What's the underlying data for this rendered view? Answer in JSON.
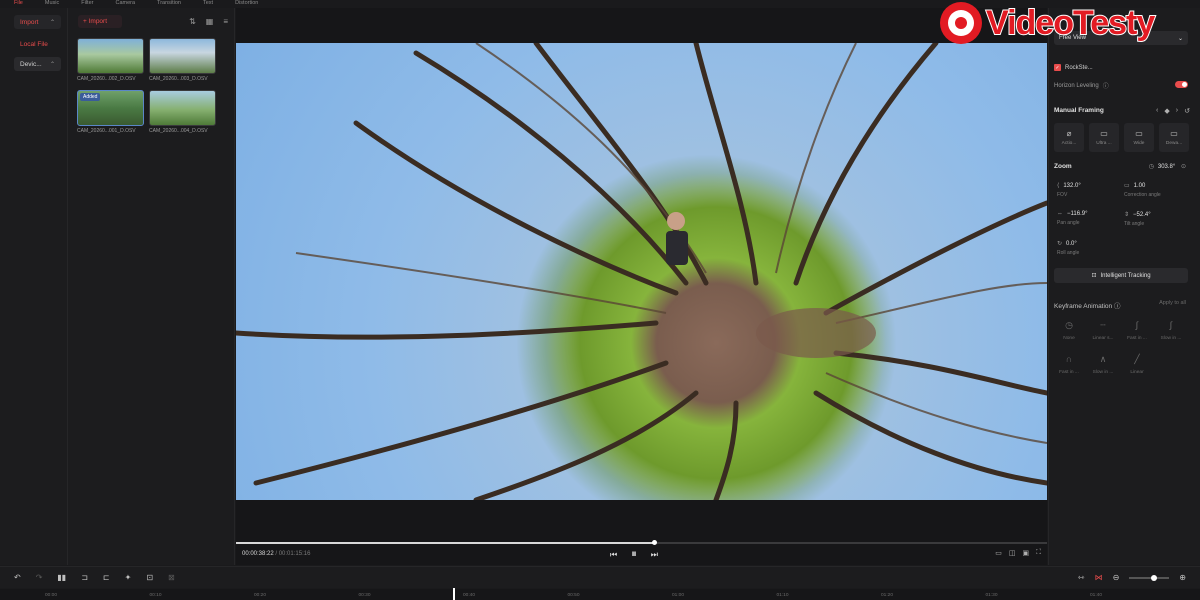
{
  "top_tabs": [
    "File",
    "Music",
    "Filter",
    "Camera",
    "Transition",
    "Text",
    "Distortion"
  ],
  "sidebar": {
    "import_label": "Import",
    "local_file_label": "Local File",
    "device_label": "Devic..."
  },
  "media": {
    "import_button": "+ Import",
    "items": [
      {
        "caption": "CAM_20260...002_D.OSV",
        "badge": ""
      },
      {
        "caption": "CAM_20260...003_D.OSV",
        "badge": ""
      },
      {
        "caption": "CAM_20260...001_D.OSV",
        "badge": "Added"
      },
      {
        "caption": "CAM_20260...004_D.OSV",
        "badge": ""
      }
    ]
  },
  "player": {
    "current_time": "00:00:38:22",
    "duration": "/ 00:01:15:16",
    "progress_fraction": 0.515
  },
  "right_panel": {
    "view_mode": "Free View",
    "rocksteady_label": "RockSte...",
    "horizon_label": "Horizon Leveling",
    "manual_framing_title": "Manual Framing",
    "presets": [
      {
        "icon": "⌀",
        "label": "Actio..."
      },
      {
        "icon": "▭",
        "label": "Ultra ..."
      },
      {
        "icon": "▭",
        "label": "Wide"
      },
      {
        "icon": "▭",
        "label": "Dewa..."
      }
    ],
    "zoom_title": "Zoom",
    "zoom_value": "303.8°",
    "fov_value": "132.0°",
    "fov_label": "FOV",
    "correction_value": "1.00",
    "correction_label": "Correction angle",
    "pan_value": "−116.9°",
    "pan_label": "Pan angle",
    "tilt_value": "−52.4°",
    "tilt_label": "Tilt angle",
    "roll_value": "0.0°",
    "roll_label": "Roll angle",
    "tracking_label": "Intelligent Tracking",
    "keyframe_title": "Keyframe Animation",
    "apply_all": "Apply to all",
    "curves": [
      "None",
      "Linear s...",
      "Fast in ...",
      "Slow in ...",
      "Fast in ...",
      "Slow in ...",
      "Linear"
    ]
  },
  "watermark": "VideoTesty",
  "timeline": {
    "ticks": [
      "00:00",
      "00:10",
      "00:20",
      "00:30",
      "00:40",
      "00:50",
      "01:00",
      "01:10",
      "01:20",
      "01:30",
      "01:40"
    ]
  }
}
